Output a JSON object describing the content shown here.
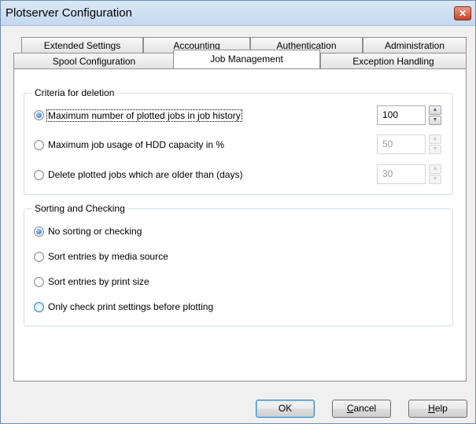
{
  "window": {
    "title": "Plotserver Configuration",
    "close_symbol": "✕"
  },
  "tabs": {
    "row1": [
      "Extended Settings",
      "Accounting",
      "Authentication",
      "Administration"
    ],
    "row2": [
      "Spool Configuration",
      "Job Management",
      "Exception Handling"
    ],
    "active": "Job Management"
  },
  "criteria": {
    "title": "Criteria for deletion",
    "options": [
      {
        "label": "Maximum number of plotted jobs in job history",
        "value": "100",
        "checked": true,
        "enabled": true
      },
      {
        "label": "Maximum job usage of HDD capacity in %",
        "value": "50",
        "checked": false,
        "enabled": false
      },
      {
        "label": "Delete plotted jobs which are older than (days)",
        "value": "30",
        "checked": false,
        "enabled": false
      }
    ]
  },
  "sorting": {
    "title": "Sorting and Checking",
    "options": [
      {
        "label": "No sorting or checking",
        "checked": true
      },
      {
        "label": "Sort entries by media source",
        "checked": false
      },
      {
        "label": "Sort entries by print size",
        "checked": false
      },
      {
        "label": "Only check print settings before plotting",
        "checked": false
      }
    ]
  },
  "buttons": {
    "ok": "OK",
    "cancel_first": "C",
    "cancel_rest": "ancel",
    "help_first": "H",
    "help_rest": "elp"
  },
  "spin_glyphs": {
    "up": "▲",
    "down": "▼"
  }
}
